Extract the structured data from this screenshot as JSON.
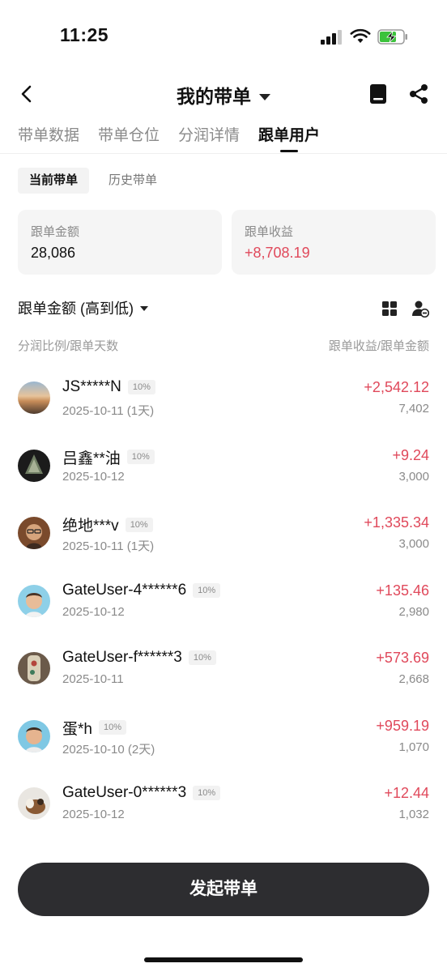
{
  "status_bar": {
    "time": "11:25"
  },
  "header": {
    "title": "我的带单"
  },
  "tabs": [
    {
      "label": "带单数据",
      "active": false
    },
    {
      "label": "带单仓位",
      "active": false
    },
    {
      "label": "分润详情",
      "active": false
    },
    {
      "label": "跟单用户",
      "active": true
    }
  ],
  "subtabs": [
    {
      "label": "当前带单",
      "active": true
    },
    {
      "label": "历史带单",
      "active": false
    }
  ],
  "stats": {
    "amount_label": "跟单金额",
    "amount_value": "28,086",
    "profit_label": "跟单收益",
    "profit_value": "+8,708.19"
  },
  "sort": {
    "label": "跟单金额 (高到低)"
  },
  "columns": {
    "left": "分润比例/跟单天数",
    "right": "跟单收益/跟单金额"
  },
  "followers": [
    {
      "name": "JS*****N",
      "share": "10%",
      "date": "2025-10-11 (1天)",
      "profit": "+2,542.12",
      "amount": "7,402"
    },
    {
      "name": "吕鑫**油",
      "share": "10%",
      "date": "2025-10-12",
      "profit": "+9.24",
      "amount": "3,000"
    },
    {
      "name": "绝地***v",
      "share": "10%",
      "date": "2025-10-11 (1天)",
      "profit": "+1,335.34",
      "amount": "3,000"
    },
    {
      "name": "GateUser-4******6",
      "share": "10%",
      "date": "2025-10-12",
      "profit": "+135.46",
      "amount": "2,980"
    },
    {
      "name": "GateUser-f******3",
      "share": "10%",
      "date": "2025-10-11",
      "profit": "+573.69",
      "amount": "2,668"
    },
    {
      "name": "蛋*h",
      "share": "10%",
      "date": "2025-10-10 (2天)",
      "profit": "+959.19",
      "amount": "1,070"
    },
    {
      "name": "GateUser-0******3",
      "share": "10%",
      "date": "2025-10-12",
      "profit": "+12.44",
      "amount": "1,032"
    }
  ],
  "cta": {
    "label": "发起带单"
  },
  "colors": {
    "positive": "#e0495b",
    "button_bg": "#2d2d30",
    "muted": "#8a8a8a"
  }
}
